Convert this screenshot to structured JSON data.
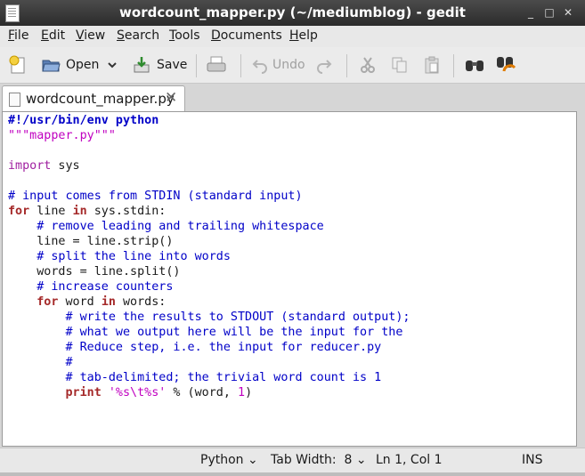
{
  "window": {
    "title": "wordcount_mapper.py (~/mediumblog) - gedit"
  },
  "menu": {
    "items": [
      "File",
      "Edit",
      "View",
      "Search",
      "Tools",
      "Documents",
      "Help"
    ]
  },
  "toolbar": {
    "open": "Open",
    "save": "Save",
    "undo": "Undo"
  },
  "tab": {
    "filename": "wordcount_mapper.py",
    "close": "✕"
  },
  "code": {
    "lines": [
      [
        {
          "t": "#!/usr/bin/env python",
          "c": "shebang"
        }
      ],
      [
        {
          "t": "\"\"\"mapper.py\"\"\"",
          "c": "str"
        }
      ],
      [],
      [
        {
          "t": "import",
          "c": "imp"
        },
        {
          "t": " sys",
          "c": "txt"
        }
      ],
      [],
      [
        {
          "t": "# input comes from STDIN (standard input)",
          "c": "cmt"
        }
      ],
      [
        {
          "t": "for",
          "c": "kw"
        },
        {
          "t": " line ",
          "c": "txt"
        },
        {
          "t": "in",
          "c": "kw"
        },
        {
          "t": " sys.stdin:",
          "c": "txt"
        }
      ],
      [
        {
          "t": "    # remove leading and trailing whitespace",
          "c": "cmt"
        }
      ],
      [
        {
          "t": "    line = line.strip()",
          "c": "txt"
        }
      ],
      [
        {
          "t": "    # split the line into words",
          "c": "cmt"
        }
      ],
      [
        {
          "t": "    words = line.split()",
          "c": "txt"
        }
      ],
      [
        {
          "t": "    # increase counters",
          "c": "cmt"
        }
      ],
      [
        {
          "t": "    ",
          "c": "txt"
        },
        {
          "t": "for",
          "c": "kw"
        },
        {
          "t": " word ",
          "c": "txt"
        },
        {
          "t": "in",
          "c": "kw"
        },
        {
          "t": " words:",
          "c": "txt"
        }
      ],
      [
        {
          "t": "        # write the results to STDOUT (standard output);",
          "c": "cmt"
        }
      ],
      [
        {
          "t": "        # what we output here will be the input for the",
          "c": "cmt"
        }
      ],
      [
        {
          "t": "        # Reduce step, i.e. the input for reducer.py",
          "c": "cmt"
        }
      ],
      [
        {
          "t": "        #",
          "c": "cmt"
        }
      ],
      [
        {
          "t": "        # tab-delimited; the trivial word count is 1",
          "c": "cmt"
        }
      ],
      [
        {
          "t": "        ",
          "c": "txt"
        },
        {
          "t": "print",
          "c": "kw"
        },
        {
          "t": " ",
          "c": "txt"
        },
        {
          "t": "'%s\\t%s'",
          "c": "str"
        },
        {
          "t": " % (word, ",
          "c": "txt"
        },
        {
          "t": "1",
          "c": "num"
        },
        {
          "t": ")",
          "c": "txt"
        }
      ]
    ]
  },
  "status": {
    "language": "Python",
    "tab_width": "Tab Width:  8",
    "position": "Ln 1, Col 1",
    "mode": "INS"
  },
  "colors": {
    "comment": "#0000c8",
    "keyword": "#a52a2a",
    "string": "#c000c0",
    "import": "#a020a0",
    "number": "#c000c0",
    "shebang": "#0000c8"
  }
}
